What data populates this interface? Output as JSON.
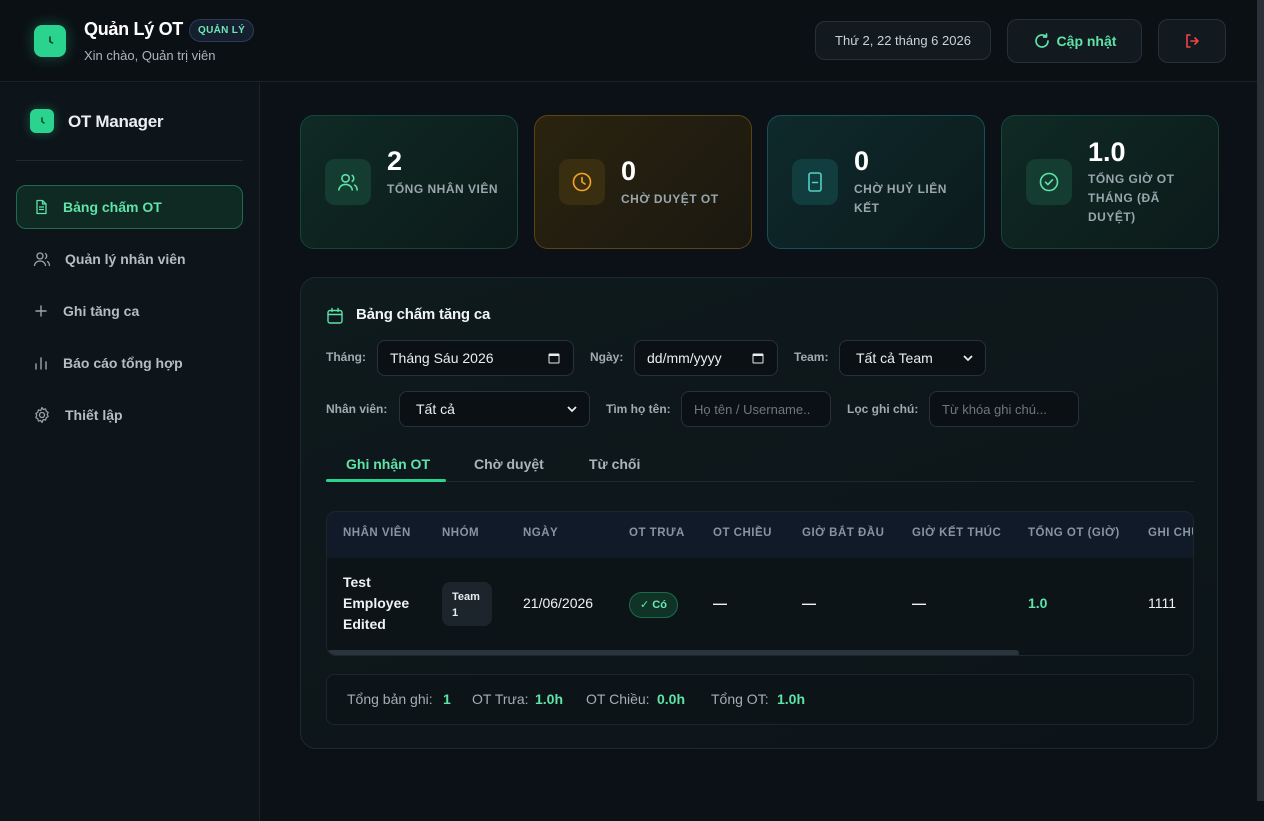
{
  "header": {
    "app_title": "Quản Lý OT",
    "role_badge": "QUẢN LÝ",
    "greeting": "Xin chào, Quản trị viên",
    "date": "Thứ 2, 22 tháng 6 2026",
    "refresh_label": "Cập nhật"
  },
  "sidebar": {
    "title": "OT Manager",
    "items": [
      {
        "label": "Bảng chấm OT",
        "icon": "document-icon",
        "active": true
      },
      {
        "label": "Quản lý nhân viên",
        "icon": "users-icon",
        "active": false
      },
      {
        "label": "Ghi tăng ca",
        "icon": "plus-icon",
        "active": false
      },
      {
        "label": "Báo cáo tổng hợp",
        "icon": "bar-chart-icon",
        "active": false
      },
      {
        "label": "Thiết lập",
        "icon": "gear-icon",
        "active": false
      }
    ]
  },
  "stats": [
    {
      "value": "2",
      "label": "TỔNG NHÂN VIÊN",
      "icon": "users-icon"
    },
    {
      "value": "0",
      "label": "CHỜ DUYỆT OT",
      "icon": "clock-icon"
    },
    {
      "value": "0",
      "label": "CHỜ HUỶ LIÊN KẾT",
      "icon": "phone-icon"
    },
    {
      "value": "1.0",
      "label": "TỔNG GIỜ OT THÁNG (ĐÃ DUYỆT)",
      "icon": "check-circle-icon"
    }
  ],
  "panel": {
    "title": "Bảng chấm tăng ca",
    "filters": {
      "month_label": "Tháng:",
      "month_value": "Tháng Sáu 2026",
      "day_label": "Ngày:",
      "day_value": "dd/mm/yyyy",
      "team_label": "Team:",
      "team_value": "Tất cả Team",
      "employee_label": "Nhân viên:",
      "employee_value": "Tất cả",
      "search_label": "Tìm họ tên:",
      "search_placeholder": "Họ tên / Username..",
      "note_label": "Lọc ghi chú:",
      "note_placeholder": "Từ khóa ghi chú..."
    },
    "tabs": [
      "Ghi nhận OT",
      "Chờ duyệt",
      "Từ chối"
    ],
    "table": {
      "headers": [
        "NHÂN VIÊN",
        "NHÓM",
        "NGÀY",
        "OT TRƯA",
        "OT CHIỀU",
        "GIỜ BẮT ĐẦU",
        "GIỜ KẾT THÚC",
        "TỔNG OT (GIỜ)",
        "GHI CHÚ"
      ],
      "rows": [
        {
          "employee_lines": [
            "Test",
            "Employee",
            "Edited"
          ],
          "team_lines": [
            "Team",
            "1"
          ],
          "date": "21/06/2026",
          "ot_noon": "✓ Có",
          "ot_afternoon": "—",
          "start": "—",
          "end": "—",
          "total": "1.0",
          "note": "1111"
        }
      ]
    },
    "summary": {
      "records_label": "Tổng bản ghi:",
      "records_value": "1",
      "noon_label": "OT Trưa:",
      "noon_value": "1.0h",
      "afternoon_label": "OT Chiều:",
      "afternoon_value": "0.0h",
      "total_label": "Tổng OT:",
      "total_value": "1.0h"
    }
  },
  "colors": {
    "accent": "#2bd48e",
    "accent_text": "#5ee3a8",
    "warning": "#f5a524",
    "danger": "#ef4444",
    "background": "#0b1116"
  }
}
